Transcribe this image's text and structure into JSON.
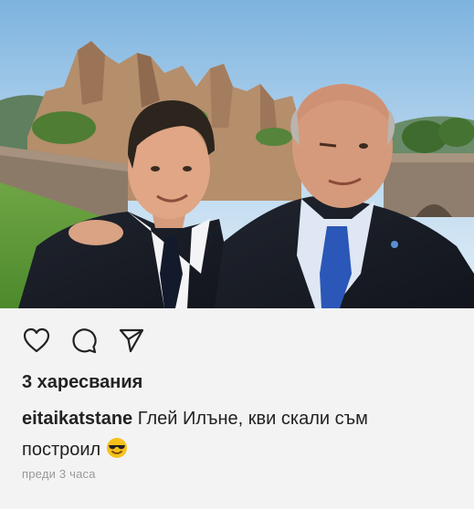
{
  "post": {
    "photo_alt": "",
    "actions": [
      {
        "name": "like",
        "icon": "heart-outline-icon"
      },
      {
        "name": "comment",
        "icon": "speech-bubble-icon"
      },
      {
        "name": "share",
        "icon": "paper-plane-icon"
      }
    ],
    "likes_text": "3 харесвания",
    "caption": {
      "username": "eitaikatstane",
      "text": "Глей Илъне, кви скали съм построил",
      "emoji": "smiling-face-with-sunglasses"
    },
    "timestamp": "преди 3 часа"
  },
  "colors": {
    "background": "#f3f3f3",
    "text": "#222222",
    "muted": "#999999",
    "emoji_yellow": "#f5c21b"
  }
}
